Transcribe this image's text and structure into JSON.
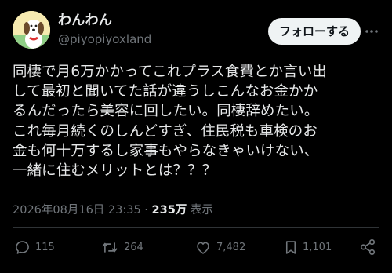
{
  "author": {
    "display_name": "わんわん",
    "handle": "@piyopiyoxland"
  },
  "follow_button": {
    "label": "フォローする"
  },
  "tweet": {
    "text": "同棲で月6万かかってこれプラス食費とか言い出\nして最初と聞いてた話が違うしこんなお金かか\nるんだったら美容に回したい。同棲辞めたい。\nこれ毎月続くのしんどすぎ、住民税も車検のお\n金も何十万するし家事もやらなきゃいけない、\n一緒に住むメリットとは？？？"
  },
  "meta": {
    "timestamp": "2026年08月16日 23:35",
    "separator": " · ",
    "views_count": "235万",
    "views_label": " 表示"
  },
  "actions": {
    "replies": "115",
    "retweets": "264",
    "likes": "7,482",
    "bookmarks": "1,101"
  },
  "icons": {
    "reply": "reply-icon",
    "retweet": "retweet-icon",
    "like": "heart-icon",
    "bookmark": "bookmark-icon",
    "share": "share-icon",
    "more": "more-icon"
  },
  "colors": {
    "background": "#000000",
    "text_primary": "#e7e9ea",
    "text_secondary": "#71767b",
    "button_bg": "#eff3f4",
    "button_text": "#0f1419",
    "divider": "#2f3336"
  }
}
